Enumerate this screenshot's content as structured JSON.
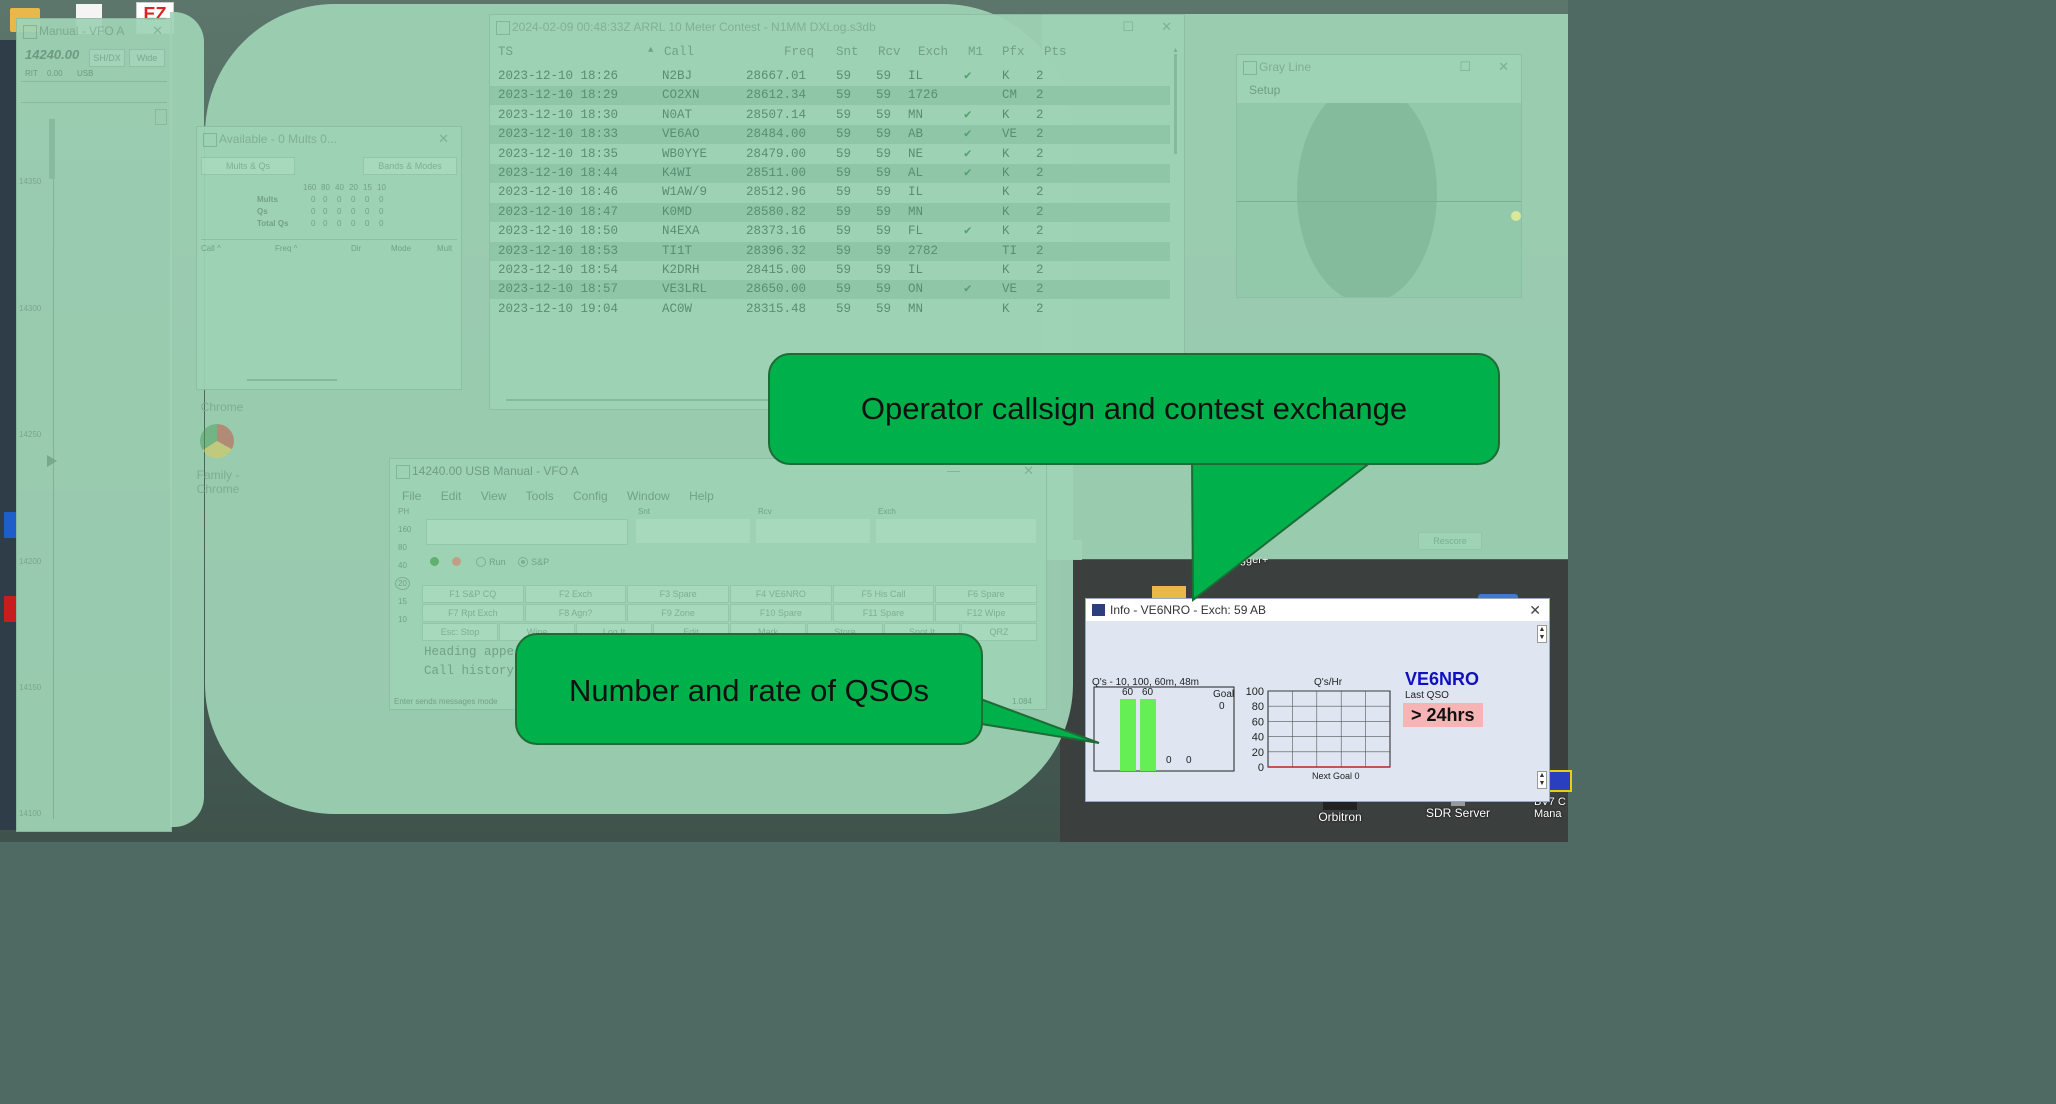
{
  "desktop": {
    "icon_ez_label": "EZ",
    "icon_orbitron_label": "Orbitron",
    "icon_sdr_label": "SDR Server",
    "icon_bv7_label": "BV7 C Mana",
    "icon_logger_label": "Logger+",
    "icon_family_chrome_label": "Family - Chrome",
    "icon_chrome2_label": "Chrome"
  },
  "vfo_window": {
    "title": "Manual - VFO A",
    "freq": "14240.00",
    "btn_shdx": "SH/DX",
    "btn_wide": "Wide",
    "rit": "RIT",
    "rit_value": "0.00",
    "mode": "USB",
    "scale_ticks": [
      "14350",
      "14300",
      "14250",
      "14200",
      "14150",
      "14100"
    ]
  },
  "available_window": {
    "title": "Available - 0 Mults 0...",
    "btn_mults": "Mults & Qs",
    "btn_bands": "Bands & Modes",
    "bands": [
      "160",
      "80",
      "40",
      "20",
      "15",
      "10"
    ],
    "rows": [
      {
        "label": "Mults",
        "values": [
          "0",
          "0",
          "0",
          "0",
          "0",
          "0"
        ]
      },
      {
        "label": "Qs",
        "values": [
          "0",
          "0",
          "0",
          "0",
          "0",
          "0"
        ]
      },
      {
        "label": "Total Qs",
        "values": [
          "0",
          "0",
          "0",
          "0",
          "0",
          "0"
        ]
      }
    ],
    "cols": [
      "Call ^",
      "Freq ^",
      "Dir",
      "Mode",
      "Mult"
    ]
  },
  "log_window": {
    "title": "2024-02-09 00:48:33Z  ARRL 10 Meter Contest - N1MM DXLog.s3db",
    "headers": [
      "TS",
      "Call",
      "Freq",
      "Snt",
      "Rcv",
      "Exch",
      "M1",
      "Pfx",
      "Pts"
    ],
    "rows": [
      {
        "ts": "2023-12-10 18:26",
        "call": "N2BJ",
        "freq": "28667.01",
        "snt": "59",
        "rcv": "59",
        "exch": "IL",
        "m1": "✔",
        "pfx": "K",
        "pts": "2"
      },
      {
        "ts": "2023-12-10 18:29",
        "call": "CO2XN",
        "freq": "28612.34",
        "snt": "59",
        "rcv": "59",
        "exch": "1726",
        "m1": "",
        "pfx": "CM",
        "pts": "2"
      },
      {
        "ts": "2023-12-10 18:30",
        "call": "N0AT",
        "freq": "28507.14",
        "snt": "59",
        "rcv": "59",
        "exch": "MN",
        "m1": "✔",
        "pfx": "K",
        "pts": "2"
      },
      {
        "ts": "2023-12-10 18:33",
        "call": "VE6AO",
        "freq": "28484.00",
        "snt": "59",
        "rcv": "59",
        "exch": "AB",
        "m1": "✔",
        "pfx": "VE",
        "pts": "2"
      },
      {
        "ts": "2023-12-10 18:35",
        "call": "WB0YYE",
        "freq": "28479.00",
        "snt": "59",
        "rcv": "59",
        "exch": "NE",
        "m1": "✔",
        "pfx": "K",
        "pts": "2"
      },
      {
        "ts": "2023-12-10 18:44",
        "call": "K4WI",
        "freq": "28511.00",
        "snt": "59",
        "rcv": "59",
        "exch": "AL",
        "m1": "✔",
        "pfx": "K",
        "pts": "2"
      },
      {
        "ts": "2023-12-10 18:46",
        "call": "W1AW/9",
        "freq": "28512.96",
        "snt": "59",
        "rcv": "59",
        "exch": "IL",
        "m1": "",
        "pfx": "K",
        "pts": "2"
      },
      {
        "ts": "2023-12-10 18:47",
        "call": "K0MD",
        "freq": "28580.82",
        "snt": "59",
        "rcv": "59",
        "exch": "MN",
        "m1": "",
        "pfx": "K",
        "pts": "2"
      },
      {
        "ts": "2023-12-10 18:50",
        "call": "N4EXA",
        "freq": "28373.16",
        "snt": "59",
        "rcv": "59",
        "exch": "FL",
        "m1": "✔",
        "pfx": "K",
        "pts": "2"
      },
      {
        "ts": "2023-12-10 18:53",
        "call": "TI1T",
        "freq": "28396.32",
        "snt": "59",
        "rcv": "59",
        "exch": "2782",
        "m1": "",
        "pfx": "TI",
        "pts": "2"
      },
      {
        "ts": "2023-12-10 18:54",
        "call": "K2DRH",
        "freq": "28415.00",
        "snt": "59",
        "rcv": "59",
        "exch": "IL",
        "m1": "",
        "pfx": "K",
        "pts": "2"
      },
      {
        "ts": "2023-12-10 18:57",
        "call": "VE3LRL",
        "freq": "28650.00",
        "snt": "59",
        "rcv": "59",
        "exch": "ON",
        "m1": "✔",
        "pfx": "VE",
        "pts": "2"
      },
      {
        "ts": "2023-12-10 19:04",
        "call": "AC0W",
        "freq": "28315.48",
        "snt": "59",
        "rcv": "59",
        "exch": "MN",
        "m1": "",
        "pfx": "K",
        "pts": "2"
      }
    ]
  },
  "grayline_window": {
    "title": "Gray Line",
    "menu_setup": "Setup",
    "rescore": "Rescore"
  },
  "entry_window": {
    "title": "14240.00 USB Manual - VFO A",
    "menu": [
      "File",
      "Edit",
      "View",
      "Tools",
      "Config",
      "Window",
      "Help"
    ],
    "field_labels": [
      "Snt",
      "Rcv",
      "Exch"
    ],
    "ph_label": "PH",
    "bands": [
      "160",
      "80",
      "40",
      "20",
      "15",
      "10"
    ],
    "radio_run": "Run",
    "radio_sp": "S&P",
    "fkeys_row1": [
      "F1 S&P CQ",
      "F2 Exch",
      "F3 Spare",
      "F4 VE6NRO",
      "F5 His Call",
      "F6 Spare"
    ],
    "fkeys_row2": [
      "F7 Rpt Exch",
      "F8 Agn?",
      "F9 Zone",
      "F10 Spare",
      "F11 Spare",
      "F12 Wipe"
    ],
    "fkeys_row3": [
      "Esc: Stop",
      "Wipe",
      "Log It",
      "Edit",
      "Mark",
      "Store",
      "Spot It",
      "QRZ"
    ],
    "heading_text": "Heading appe",
    "history_text": "Call history",
    "status_text": "Enter sends messages mode",
    "status_right": "1.084"
  },
  "info_window": {
    "title": "Info - VE6NRO - Exch: 59 AB",
    "qs_chart_title": "Q's - 10, 100, 60m, 48m",
    "goal_label": "Goal",
    "goal_value": "0",
    "rate_title": "Q's/Hr",
    "next_goal": "Next Goal 0",
    "callsign": "VE6NRO",
    "last_qso_label": "Last QSO",
    "last_qso_value": "> 24hrs",
    "colors": {
      "callsign": "#1010c0",
      "bar": "#66ee55",
      "last_qso_bg": "#f7b4b4"
    }
  },
  "chart_data": [
    {
      "type": "bar",
      "title": "Q's - 10, 100, 60m, 48m",
      "categories": [
        "10",
        "100",
        "60m",
        "48m"
      ],
      "values": [
        60,
        60,
        0,
        0
      ],
      "ylim": [
        0,
        70
      ]
    },
    {
      "type": "line",
      "title": "Q's/Hr",
      "xlabel": "Next Goal 0",
      "ylim": [
        0,
        100
      ],
      "yticks": [
        0,
        20,
        40,
        60,
        80,
        100
      ],
      "series": [
        {
          "values": [
            0,
            0,
            0,
            0,
            0
          ]
        }
      ]
    }
  ],
  "callouts": {
    "top": "Operator callsign and contest exchange",
    "bottom": "Number and rate of QSOs"
  }
}
